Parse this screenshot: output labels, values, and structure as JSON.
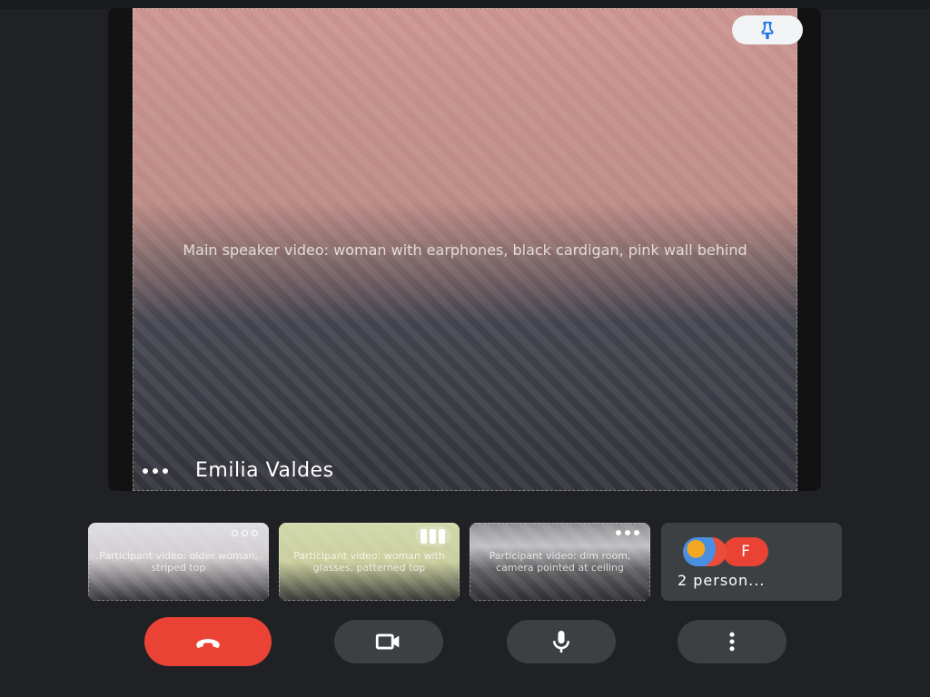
{
  "main_tile": {
    "participant_name": "Emilia Valdes",
    "video_placeholder": "Main speaker video: woman with earphones, black cardigan, pink wall behind"
  },
  "thumbnails": [
    {
      "placeholder": "Participant video: older woman, striped top",
      "status": "menu"
    },
    {
      "placeholder": "Participant video: woman with glasses, patterned top",
      "status": "speaking"
    },
    {
      "placeholder": "Participant video: dim room, camera pointed at ceiling",
      "status": "menu"
    },
    {
      "avatar_letter": "F",
      "label": "2 person..."
    }
  ],
  "colors": {
    "background": "#202124",
    "tile": "#3c4043",
    "end_call": "#ea4335",
    "accent_blue": "#1a73e8"
  },
  "icons": {
    "pin": "pin-icon",
    "end_call": "phone-hangup-icon",
    "camera": "videocam-icon",
    "mic": "mic-icon",
    "more": "more-vert-icon"
  }
}
